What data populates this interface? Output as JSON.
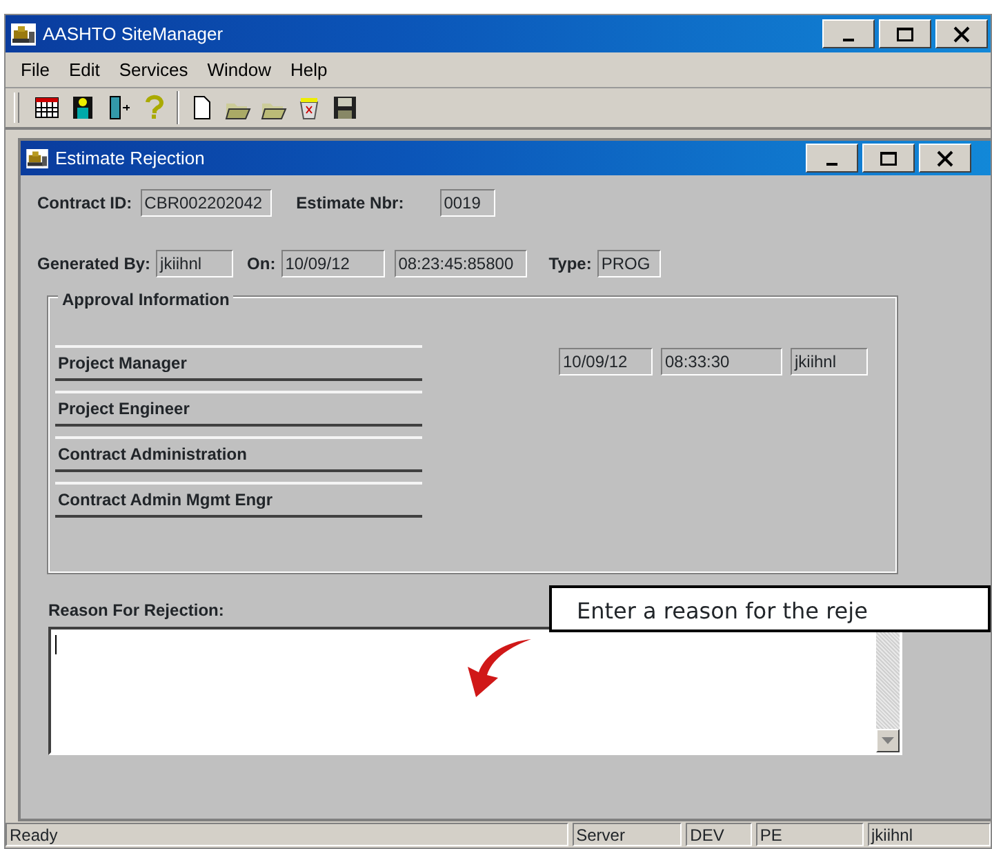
{
  "app": {
    "title": "AASHTO SiteManager"
  },
  "menu": [
    "File",
    "Edit",
    "Services",
    "Window",
    "Help"
  ],
  "child_window": {
    "title": "Estimate Rejection"
  },
  "contract": {
    "id_label": "Contract ID:",
    "id": "CBR002202042",
    "estimate_label": "Estimate Nbr:",
    "estimate": "0019"
  },
  "generated": {
    "label": "Generated By:",
    "by": "jkiihnl",
    "on_label": "On:",
    "date": "10/09/12",
    "time": "08:23:45:85800",
    "type_label": "Type:",
    "type": "PROG"
  },
  "approval": {
    "title": "Approval Information",
    "rows": [
      {
        "role": "Project Manager",
        "date": "10/09/12",
        "time": "08:33:30",
        "user": "jkiihnl"
      },
      {
        "role": "Project Engineer"
      },
      {
        "role": "Contract Administration"
      },
      {
        "role": "Contract Admin Mgmt Engr"
      }
    ]
  },
  "reason": {
    "label": "Reason For Rejection:"
  },
  "callout": "Enter a reason for the reje",
  "status_bar": [
    "Ready",
    "Server",
    "DEV",
    "PE",
    "jkiihnl"
  ]
}
